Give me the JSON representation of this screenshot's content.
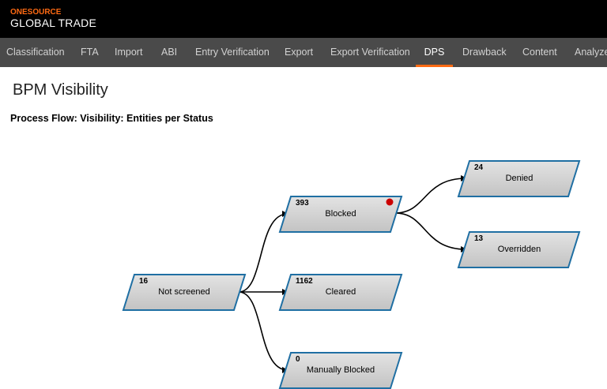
{
  "brand": {
    "line1": "ONESOURCE",
    "line2": "GLOBAL TRADE"
  },
  "nav": {
    "items": [
      {
        "label": "Classification"
      },
      {
        "label": "FTA"
      },
      {
        "label": "Import"
      },
      {
        "label": "ABI"
      },
      {
        "label": "Entry Verification"
      },
      {
        "label": "Export"
      },
      {
        "label": "Export Verification"
      },
      {
        "label": "DPS",
        "active": true
      },
      {
        "label": "Drawback"
      },
      {
        "label": "Content"
      },
      {
        "label": "Analyze"
      }
    ]
  },
  "page": {
    "title": "BPM Visibility",
    "section_title": "Process Flow: Visibility: Entities per Status"
  },
  "flow": {
    "nodes": [
      {
        "id": "not_screened",
        "count": "16",
        "label": "Not screened"
      },
      {
        "id": "blocked",
        "count": "393",
        "label": "Blocked",
        "alert": true
      },
      {
        "id": "cleared",
        "count": "1162",
        "label": "Cleared"
      },
      {
        "id": "manually_blocked",
        "count": "0",
        "label": "Manually Blocked"
      },
      {
        "id": "denied",
        "count": "24",
        "label": "Denied"
      },
      {
        "id": "overridden",
        "count": "13",
        "label": "Overridden"
      }
    ],
    "edges": [
      {
        "from": "not_screened",
        "to": "blocked"
      },
      {
        "from": "not_screened",
        "to": "cleared"
      },
      {
        "from": "not_screened",
        "to": "manually_blocked"
      },
      {
        "from": "blocked",
        "to": "denied"
      },
      {
        "from": "blocked",
        "to": "overridden"
      }
    ]
  },
  "colors": {
    "accent": "#ff6a13",
    "node_fill": "#cfcfcf",
    "node_border": "#1f6fa3",
    "alert": "#cc0000"
  }
}
